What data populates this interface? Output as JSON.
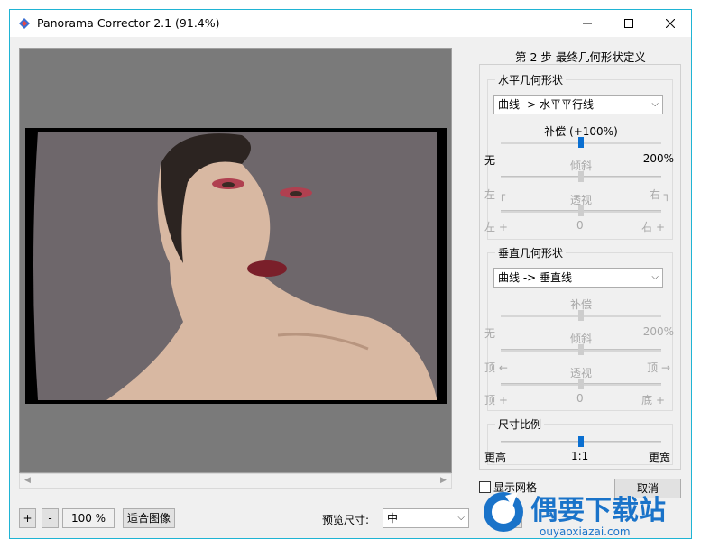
{
  "window": {
    "title": "Panorama Corrector 2.1 (91.4%)",
    "accent": "#1fb4d4"
  },
  "titlebar_buttons": {
    "minimize": "minimize-icon",
    "maximize": "maximize-icon",
    "close": "close-icon"
  },
  "toolbar": {
    "zoom_in": "+",
    "zoom_out": "-",
    "zoom_value": "100 %",
    "fit_image": "适合图像",
    "preview_size_label": "预览尺寸:",
    "preview_size_value": "中"
  },
  "side": {
    "step_title": "第 2 步  最终几何形状定义",
    "horizontal": {
      "title": "水平几何形状",
      "mode": "曲线 -> 水平平行线",
      "comp_label": "补偿 (+100%)",
      "comp_min": "无",
      "comp_max": "200%",
      "comp_value": 0.5,
      "tilt_label": "倾斜",
      "tilt_left": "左 ┌",
      "tilt_right": "右 ┐",
      "persp_label": "透视",
      "persp_left": "左 +",
      "persp_zero": "0",
      "persp_right": "右 +"
    },
    "vertical": {
      "title": "垂直几何形状",
      "mode": "曲线 -> 垂直线",
      "comp_label": "补偿",
      "comp_min": "无",
      "comp_max": "200%",
      "tilt_label": "倾斜",
      "tilt_left": "顶 ←",
      "tilt_right": "顶 →",
      "persp_label": "透视",
      "persp_left": "顶 +",
      "persp_zero": "0",
      "persp_right": "底 +"
    },
    "ratio": {
      "title": "尺寸比例",
      "left": "更高",
      "center": "1:1",
      "right": "更宽",
      "value": 0.5
    }
  },
  "grid_label": "显示网格",
  "cancel_label": "取消",
  "help_label": "?",
  "watermark": {
    "text": "偶要下载站",
    "sub": "ouyaoxiazai.com",
    "color": "#1a73c9"
  }
}
